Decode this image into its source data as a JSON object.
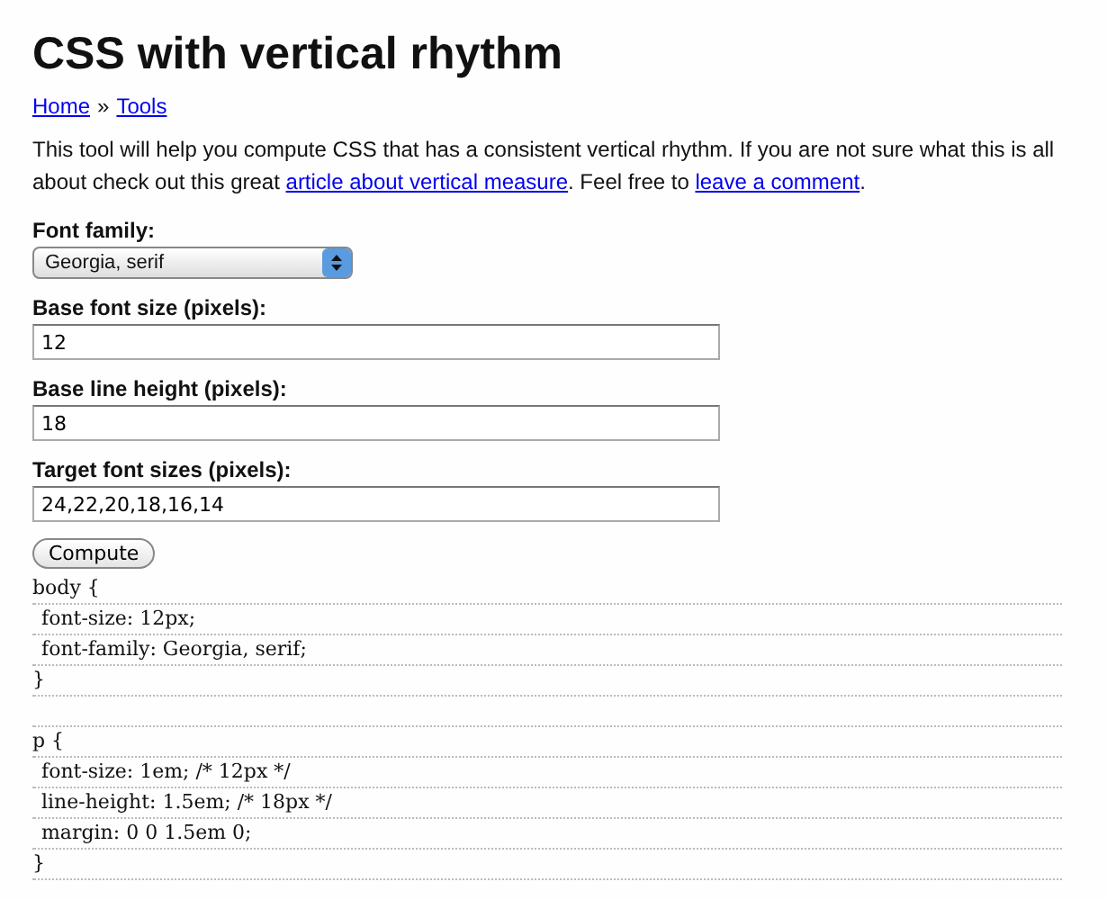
{
  "title": "CSS with vertical rhythm",
  "breadcrumb": {
    "links": [
      "Home",
      "Tools"
    ],
    "separator": "»"
  },
  "intro": {
    "before": "This tool will help you compute CSS that has a consistent vertical rhythm. If you are not sure what this is all about check out this great",
    "link1": "article about vertical measure",
    "middle": ". Feel free to",
    "link2": "leave a comment",
    "after": "."
  },
  "form": {
    "fields": [
      {
        "kind": "select",
        "label": "Font family:",
        "value": "Georgia, serif"
      },
      {
        "kind": "text",
        "label": "Base font size (pixels):",
        "value": "12"
      },
      {
        "kind": "text",
        "label": "Base line height (pixels):",
        "value": "18"
      },
      {
        "kind": "text",
        "label": "Target font sizes (pixels):",
        "value": "24,22,20,18,16,14"
      }
    ],
    "button": "Compute"
  },
  "output": [
    {
      "open": "body {",
      "lines": [
        "font-size: 12px;",
        "font-family: Georgia, serif;"
      ],
      "close": "}"
    },
    {
      "open": "p {",
      "lines": [
        "font-size: 1em; /* 12px */",
        "line-height: 1.5em; /* 18px */",
        "margin: 0 0 1.5em 0;"
      ],
      "close": "}"
    }
  ]
}
